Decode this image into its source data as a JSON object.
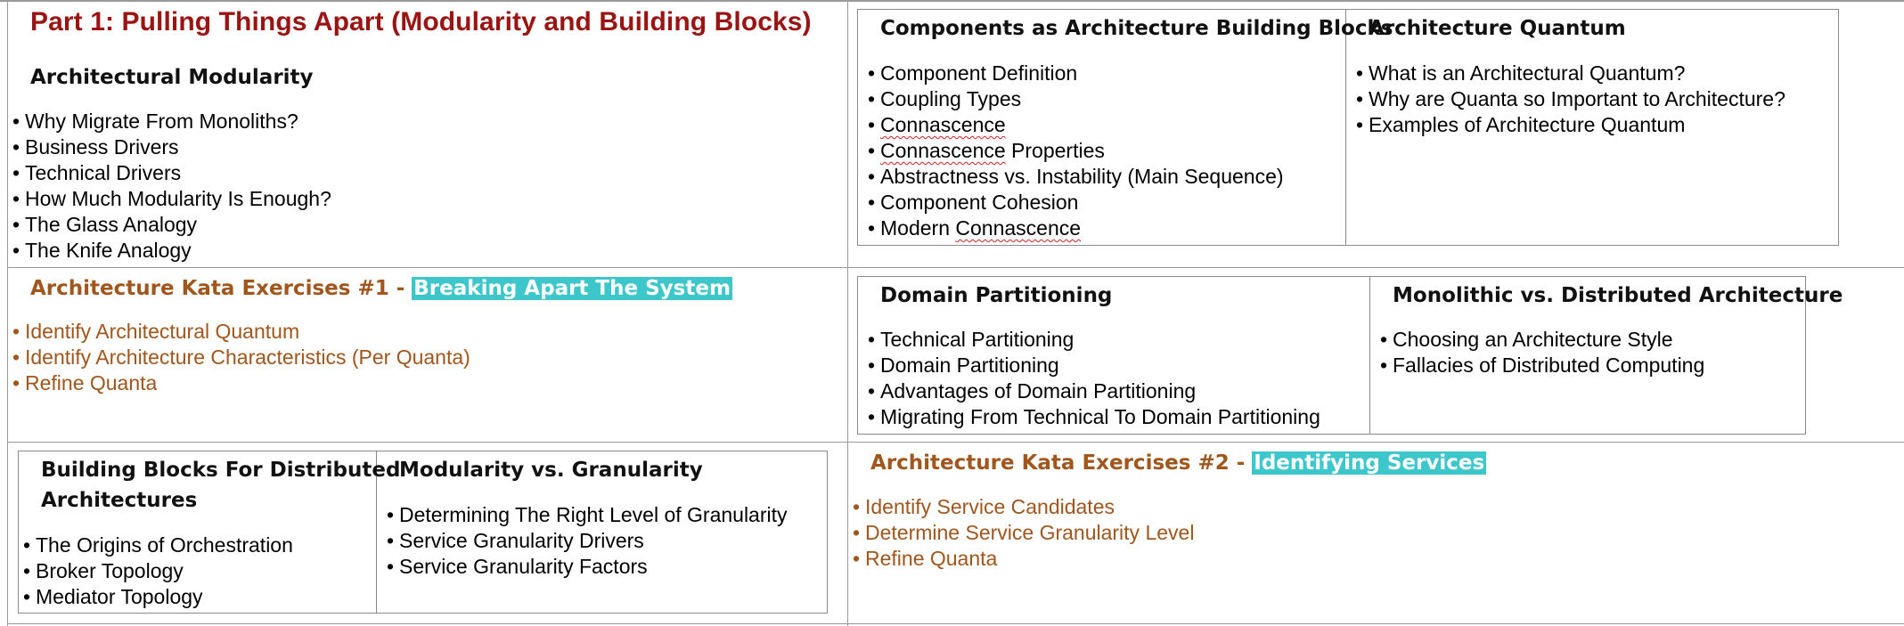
{
  "part_title": "Part 1: Pulling Things Apart (Modularity and Building Blocks)",
  "architectural_modularity": {
    "title": "Architectural Modularity",
    "items": [
      "Why Migrate From Monoliths?",
      "Business Drivers",
      "Technical Drivers",
      "How Much Modularity Is Enough?",
      "The Glass Analogy",
      "The Knife Analogy"
    ]
  },
  "components": {
    "title": "Components as Architecture Building Blocks",
    "item1": "Component Definition",
    "item2": "Coupling Types",
    "item3": "Connascence",
    "item4_a": "Connascence",
    "item4_b": " Properties",
    "item5": "Abstractness vs. Instability (Main Sequence)",
    "item6": "Component Cohesion",
    "item7_a": "Modern ",
    "item7_b": "Connascence"
  },
  "quantum": {
    "title": "Architecture Quantum",
    "items": [
      "What is an Architectural Quantum?",
      "Why are Quanta so Important to Architecture?",
      "Examples of Architecture Quantum"
    ]
  },
  "kata1": {
    "title": "Architecture Kata Exercises #1 - ",
    "highlight": "Breaking Apart The System",
    "items": [
      "Identify Architectural Quantum",
      "Identify Architecture Characteristics (Per Quanta)",
      "Refine Quanta"
    ]
  },
  "domain_partitioning": {
    "title": "Domain Partitioning",
    "items": [
      "Technical Partitioning",
      "Domain Partitioning",
      "Advantages of Domain Partitioning",
      "Migrating From Technical To Domain Partitioning"
    ]
  },
  "mono_vs_dist": {
    "title": "Monolithic vs. Distributed Architecture",
    "items": [
      "Choosing an Architecture Style",
      "Fallacies of Distributed Computing"
    ]
  },
  "building_blocks": {
    "title_line1": "Building Blocks For Distributed",
    "title_line2": "Architectures",
    "items": [
      "The Origins of Orchestration",
      "Broker Topology",
      "Mediator Topology"
    ]
  },
  "modularity_granularity": {
    "title": "Modularity vs. Granularity",
    "items": [
      "Determining The Right Level of Granularity",
      "Service Granularity Drivers",
      "Service Granularity Factors"
    ]
  },
  "kata2": {
    "title": "Architecture Kata Exercises #2 - ",
    "highlight": "Identifying Services",
    "items": [
      "Identify Service Candidates",
      "Determine Service Granularity Level",
      "Refine Quanta"
    ]
  }
}
